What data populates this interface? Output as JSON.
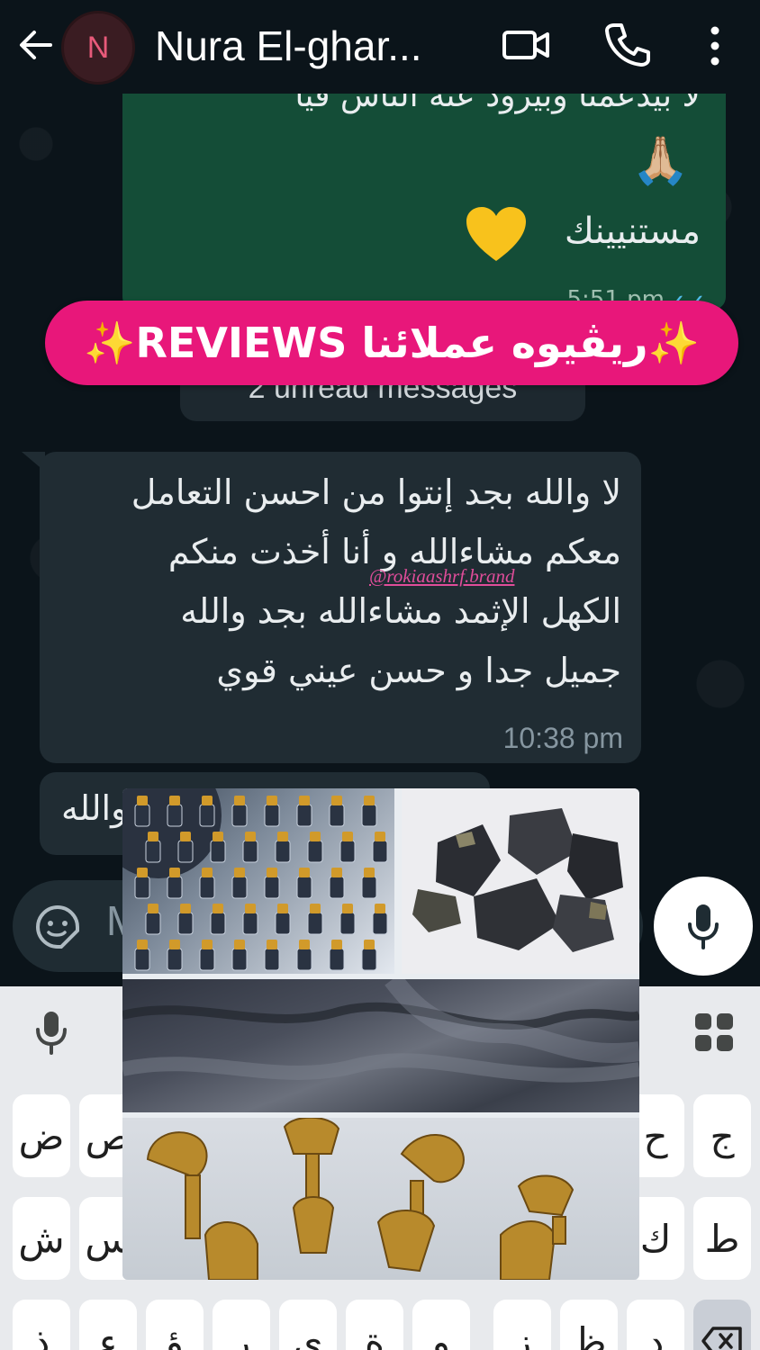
{
  "header": {
    "avatar_initial": "N",
    "contact_name": "Nura El-ghar...",
    "icons": [
      "back-arrow-icon",
      "video-call-icon",
      "phone-icon",
      "more-vert-icon"
    ]
  },
  "outgoing_message": {
    "top_line": "لا بيدعمنا وبيرود عنه الناس قيا",
    "emoji_hands": "🙏🏼",
    "waiting_text": "مستنيينك",
    "emoji_heart": "💛",
    "time": "5:51 pm"
  },
  "banner": {
    "text": "✨ريڤيوه عملائنا REVIEWS✨",
    "color": "#e8177a"
  },
  "unread_label": "2 unread messages",
  "incoming_message": {
    "lines": [
      "لا والله بجد إنتوا من احسن التعامل",
      "معكم مشاءالله و أنا أخذت منكم",
      "الكهل الإثمد مشاءالله بجد والله",
      "جميل جدا و حسن عيني قوي"
    ],
    "time": "10:38 pm"
  },
  "watermark": "@rokiaashrf.brand",
  "incoming_message_2": {
    "text": "والله"
  },
  "composer": {
    "placeholder": "M"
  },
  "keyboard": {
    "row1_left": [
      "ض",
      "ص"
    ],
    "row1_right": [
      "ح",
      "ج"
    ],
    "row2_left": [
      "ش",
      "س"
    ],
    "row2_right": [
      "ك",
      "ط"
    ],
    "row3": [
      "ذ",
      "ء",
      "ؤ",
      "ر",
      "ى",
      "ة",
      "و",
      "ز",
      "ظ",
      "د"
    ]
  },
  "collage": {
    "photos": [
      "kohl-bottles-photo",
      "antimony-stones-photo",
      "kohl-powder-photo",
      "brass-mukhula-photo"
    ]
  },
  "colors": {
    "chat_bg": "#0b141a",
    "outgoing_bubble": "#144d37",
    "incoming_bubble": "#202c33",
    "keyboard_bg": "#e8eaed"
  }
}
